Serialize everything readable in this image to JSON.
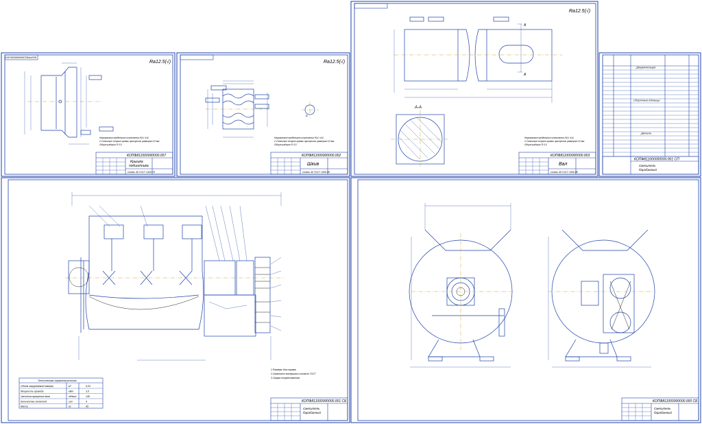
{
  "sheets": {
    "cover": {
      "stamp": "КОПФ811000000000.007",
      "title_line1": "Крышка",
      "title_line2": "подшипника",
      "material": "Сталь 40 ГОСТ 1420-79",
      "roughness": "Ra12.5(√)",
      "notes": [
        "Неуказанные предельные отклонения Н14, h14,",
        "2.Сплошные острые кромки притупить размером 0,5 мм",
        "Общие радиусы R 0,5"
      ]
    },
    "pulley": {
      "stamp": "КОПФ811000000000.002",
      "title": "Шкив",
      "material": "Сталь 40 ГОСТ 1050-99",
      "roughness": "Ra12.5(√)",
      "notes": [
        "Неуказанные предельные отклонения Н14, h14,",
        "2.Сплошные острые кромки притупить размером 0,5 мм",
        "Общие радиусы R 0,5"
      ]
    },
    "shaft": {
      "stamp": "КОПФ811000000000.003",
      "title": "Вал",
      "material": "Сталь 45 ГОСТ 1050-88",
      "roughness": "Ra12.5(√)",
      "section_label": "А-А",
      "notes": [
        "Неуказанные предельные отклонения Н14, h14,",
        "2.Сплошные острые кромки притупить размером 0,5 мм",
        "Общие радиусы R 0,5"
      ]
    },
    "spec": {
      "stamp": "КОПФ811000000000.001 СП",
      "title_line1": "Смеситель",
      "title_line2": "барабанный",
      "sections": [
        "Документация",
        "Сборочные единицы",
        "Детали"
      ]
    },
    "assembly": {
      "stamp": "КОПФ811000000000.001 СБ",
      "title_line1": "Смеситель",
      "title_line2": "барабанный",
      "table_title": "Техническая характеристика",
      "table_rows": [
        [
          "Объем загружаемой камеры",
          "м³",
          "0,03"
        ],
        [
          "Мощность привода",
          "кВт",
          "3,0"
        ],
        [
          "Частота вращения вала",
          "об/мин",
          "140"
        ],
        [
          "Количество лопастей",
          "шт",
          "4"
        ],
        [
          "Масса",
          "кг",
          "95"
        ]
      ],
      "notes": [
        "1.Размеры для справок",
        "2.Смазочные материалы согласно ГОСТ",
        "3.Сварка полуавтоматом"
      ]
    },
    "general": {
      "stamp": "КОПФ811000000000.000 СБ",
      "title_line1": "Смеситель",
      "title_line2": "барабанный"
    }
  }
}
